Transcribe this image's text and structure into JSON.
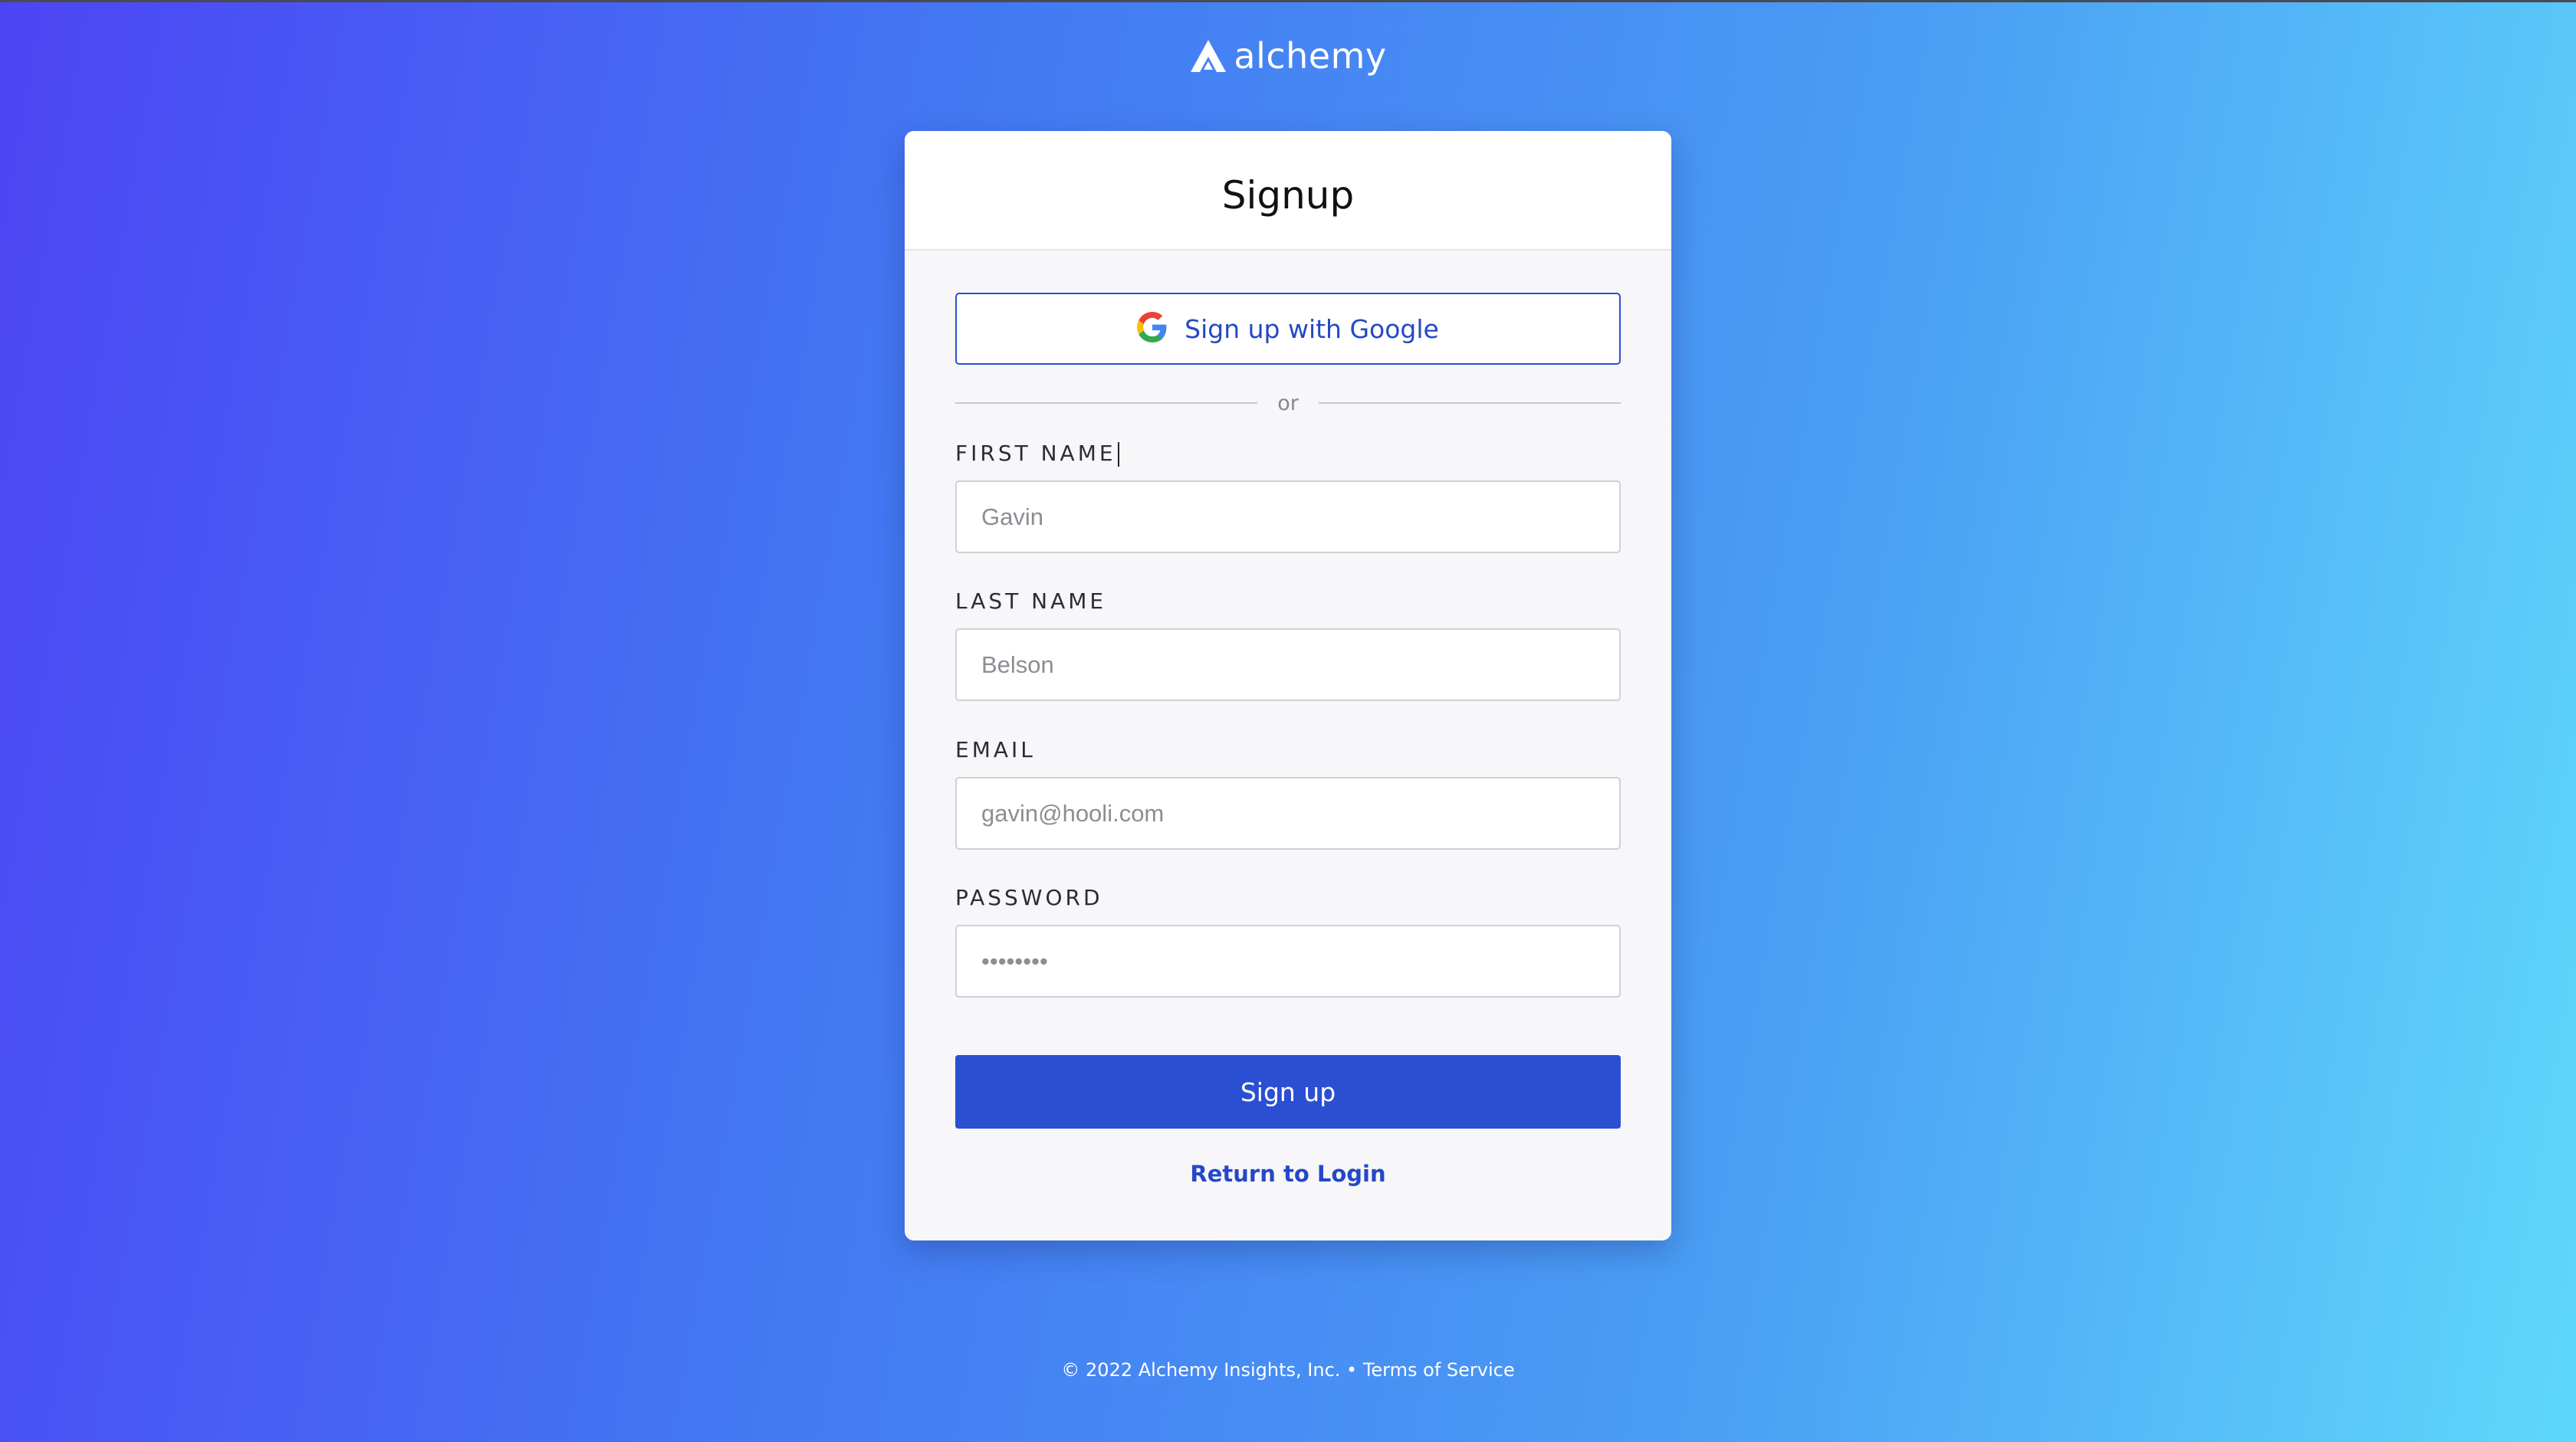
{
  "brand": {
    "name": "alchemy",
    "logo_icon": "alchemy-logo-icon"
  },
  "card": {
    "title": "Signup",
    "google_button_label": "Sign up with Google",
    "divider_text": "or",
    "fields": {
      "first_name": {
        "label": "FIRST NAME",
        "placeholder": "Gavin"
      },
      "last_name": {
        "label": "LAST NAME",
        "placeholder": "Belson"
      },
      "email": {
        "label": "EMAIL",
        "placeholder": "gavin@hooli.com"
      },
      "password": {
        "label": "PASSWORD",
        "placeholder": "••••••••"
      }
    },
    "submit_label": "Sign up",
    "return_link": "Return to Login"
  },
  "footer": {
    "copyright": "© 2022 Alchemy Insights, Inc. •",
    "terms_link": "Terms of Service"
  },
  "colors": {
    "accent": "#2b4fd3",
    "link": "#2448c7",
    "gradient_start": "#4c45f4",
    "gradient_end": "#5fd7fb"
  }
}
